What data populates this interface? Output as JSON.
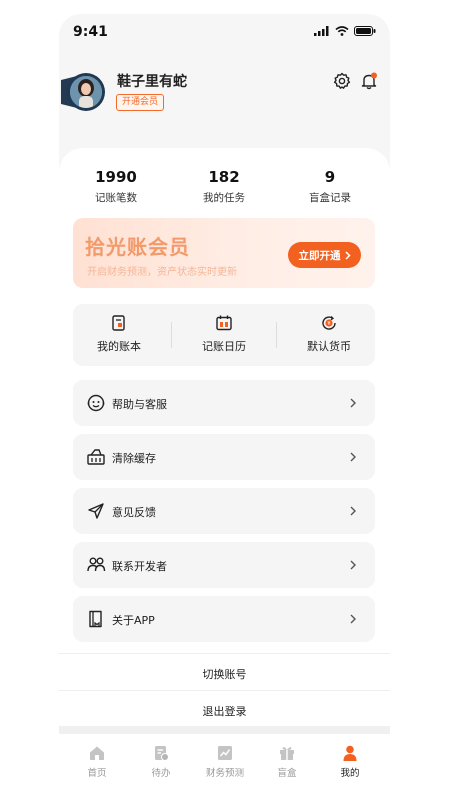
{
  "status_bar": {
    "time": "9:41"
  },
  "profile": {
    "username": "鞋子里有蛇",
    "vip_badge": "开通会员"
  },
  "stats": [
    {
      "value": "1990",
      "label": "记账笔数"
    },
    {
      "value": "182",
      "label": "我的任务"
    },
    {
      "value": "9",
      "label": "盲盒记录"
    }
  ],
  "banner": {
    "title": "拾光账会员",
    "subtitle": "开启财务预测，资产状态实时更新",
    "cta": "立即开通"
  },
  "quick_access": [
    {
      "label": "我的账本",
      "icon": "ledger-icon"
    },
    {
      "label": "记账日历",
      "icon": "calendar-icon"
    },
    {
      "label": "默认货币",
      "icon": "currency-icon"
    }
  ],
  "menu": [
    {
      "label": "帮助与客服",
      "icon": "support-icon"
    },
    {
      "label": "清除缓存",
      "icon": "basket-icon"
    },
    {
      "label": "意见反馈",
      "icon": "send-icon"
    },
    {
      "label": "联系开发者",
      "icon": "users-icon"
    },
    {
      "label": "关于APP",
      "icon": "book-icon"
    }
  ],
  "actions": {
    "switch_account": "切换账号",
    "logout": "退出登录"
  },
  "tabbar": [
    {
      "label": "首页",
      "icon": "home-icon"
    },
    {
      "label": "待办",
      "icon": "todo-icon"
    },
    {
      "label": "财务预测",
      "icon": "chart-icon"
    },
    {
      "label": "盲盒",
      "icon": "gift-icon"
    },
    {
      "label": "我的",
      "icon": "person-icon",
      "active": true
    }
  ],
  "colors": {
    "accent": "#f2611f",
    "banner_title": "#f29a6b",
    "background": "#f6f6f6"
  }
}
